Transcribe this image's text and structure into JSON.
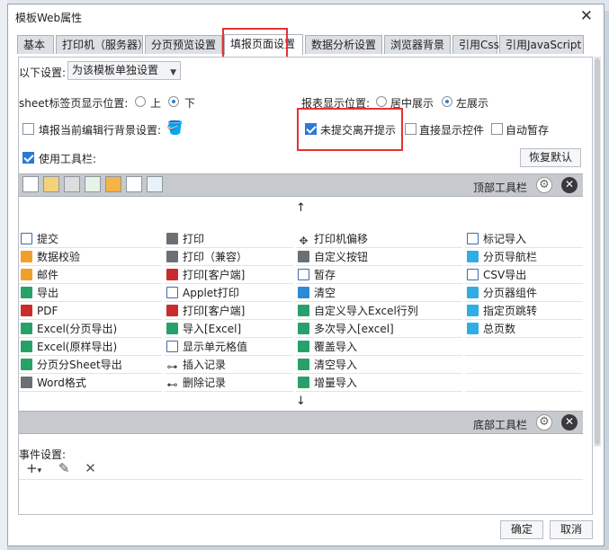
{
  "window": {
    "title": "模板Web属性"
  },
  "tabs": [
    "基本",
    "打印机（服务器）",
    "分页预览设置",
    "填报页面设置",
    "数据分析设置",
    "浏览器背景",
    "引用Css",
    "引用JavaScript"
  ],
  "settings": {
    "scope_label": "以下设置:",
    "scope_value": "为该模板单独设置",
    "sheet_pos_label": "sheet标签页显示位置:",
    "sheet_top": "上",
    "sheet_bottom": "下",
    "report_pos_label": "报表显示位置:",
    "report_center": "居中展示",
    "report_left": "左展示",
    "edit_bg_label": "填报当前编辑行背景设置:",
    "unsubmitted_label": "未提交离开提示",
    "show_controls_label": "直接显示控件",
    "auto_save_label": "自动暂存",
    "use_toolbar_label": "使用工具栏:",
    "restore_default": "恢复默认"
  },
  "toolbars": {
    "top_label": "顶部工具栏",
    "bottom_label": "底部工具栏",
    "up_arrow": "↑",
    "down_arrow": "↓"
  },
  "buttons_grid": {
    "col1": [
      "提交",
      "数据校验",
      "邮件",
      "导出",
      "PDF",
      "Excel(分页导出)",
      "Excel(原样导出)",
      "分页分Sheet导出",
      "Word格式"
    ],
    "col2": [
      "打印",
      "打印（兼容）",
      "打印[客户端]",
      "Applet打印",
      "打印[客户端]",
      "导入[Excel]",
      "显示单元格值",
      "插入记录",
      "删除记录"
    ],
    "col3": [
      "打印机偏移",
      "自定义按钮",
      "暂存",
      "清空",
      "自定义导入Excel行列",
      "多次导入[excel]",
      "覆盖导入",
      "清空导入",
      "增量导入"
    ],
    "col4": [
      "标记导入",
      "分页导航栏",
      "CSV导出",
      "分页器组件",
      "指定页跳转",
      "总页数",
      "",
      "",
      ""
    ]
  },
  "events": {
    "label": "事件设置:",
    "add": "+",
    "edit": "✎",
    "delete": "✕"
  },
  "footer": {
    "ok": "确定",
    "cancel": "取消"
  }
}
